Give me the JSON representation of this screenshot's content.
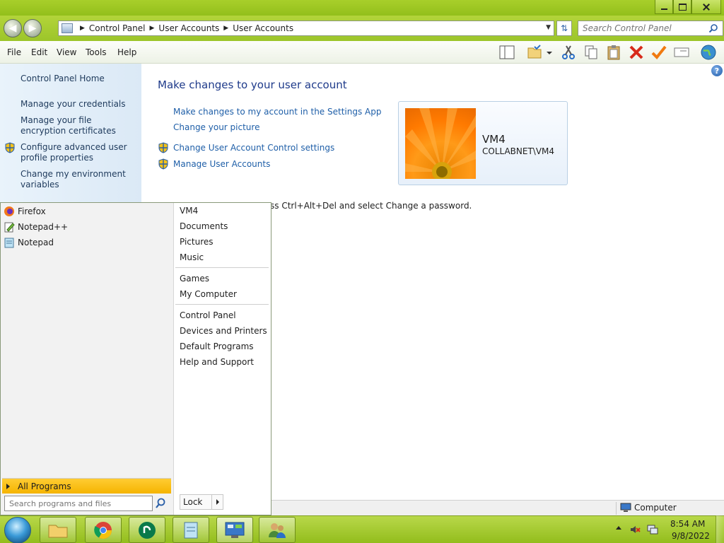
{
  "window": {
    "address": {
      "crumbs": [
        "Control Panel",
        "User Accounts",
        "User Accounts"
      ]
    },
    "search_placeholder": "Search Control Panel"
  },
  "menubar": {
    "items": [
      "File",
      "Edit",
      "View",
      "Tools",
      "Help"
    ]
  },
  "sidebar": {
    "home": "Control Panel Home",
    "links": [
      "Manage your credentials",
      "Manage your file encryption certificates",
      "Configure advanced user profile properties",
      "Change my environment variables"
    ]
  },
  "main": {
    "title": "Make changes to your user account",
    "tasks": [
      "Make changes to my account in the Settings App",
      "Change your picture",
      "Change User Account Control settings",
      "Manage User Accounts"
    ],
    "user": {
      "name": "VM4",
      "domain": "COLLABNET\\VM4"
    },
    "password_hint": "ss Ctrl+Alt+Del and select Change a password."
  },
  "statusbar": {
    "computer": "Computer"
  },
  "start_menu": {
    "programs": [
      "Firefox",
      "Notepad++",
      "Notepad"
    ],
    "all_programs": "All Programs",
    "search_placeholder": "Search programs and files",
    "right_items": {
      "group1": [
        "VM4",
        "Documents",
        "Pictures",
        "Music"
      ],
      "group2": [
        "Games",
        "My Computer"
      ],
      "group3": [
        "Control Panel",
        "Devices and Printers",
        "Default Programs",
        "Help and Support"
      ]
    },
    "lock": "Lock"
  },
  "taskbar": {
    "time": "8:54 AM",
    "date": "9/8/2022"
  },
  "colors": {
    "taskbar_green": "#9cc52a",
    "link_blue": "#1f5fa8",
    "all_programs_highlight": "#f5b400"
  }
}
